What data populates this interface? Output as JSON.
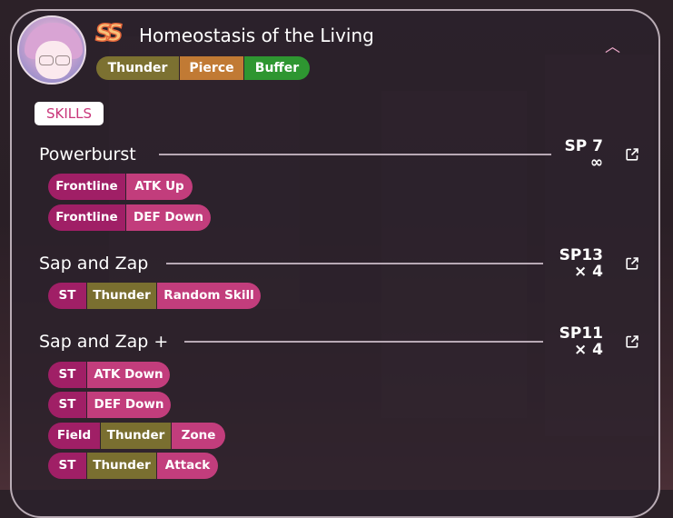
{
  "unit": {
    "title": "Homeostasis of the Living",
    "rank_icon": "ss-rank-icon",
    "tags": [
      {
        "label": "Thunder",
        "color": "#7c7131"
      },
      {
        "label": "Pierce",
        "color": "#c17a34"
      },
      {
        "label": "Buffer",
        "color": "#2e9631"
      }
    ]
  },
  "section_label": "SKILLS",
  "skills": [
    {
      "name": "Powerburst",
      "sp": "SP 7",
      "uses": "∞",
      "effects": [
        [
          "Frontline",
          "ATK Up"
        ],
        [
          "Frontline",
          "DEF Down"
        ]
      ]
    },
    {
      "name": "Sap and Zap",
      "sp": "SP13",
      "uses": "× 4",
      "effects": [
        [
          "ST",
          "Thunder",
          "Random Skill"
        ]
      ]
    },
    {
      "name": "Sap and Zap +",
      "sp": "SP11",
      "uses": "× 4",
      "effects": [
        [
          "ST",
          "ATK Down"
        ],
        [
          "ST",
          "DEF Down"
        ],
        [
          "Field",
          "Thunder",
          "Zone"
        ],
        [
          "ST",
          "Thunder",
          "Attack"
        ]
      ]
    }
  ],
  "colors": {
    "accent_pink": "#c9367a",
    "chip_dark": "#a01f66",
    "chip_pink": "#c23d7c",
    "thunder": "#7a6f30"
  },
  "icons": {
    "collapse": "chevron-up-icon",
    "open": "external-link-icon"
  }
}
